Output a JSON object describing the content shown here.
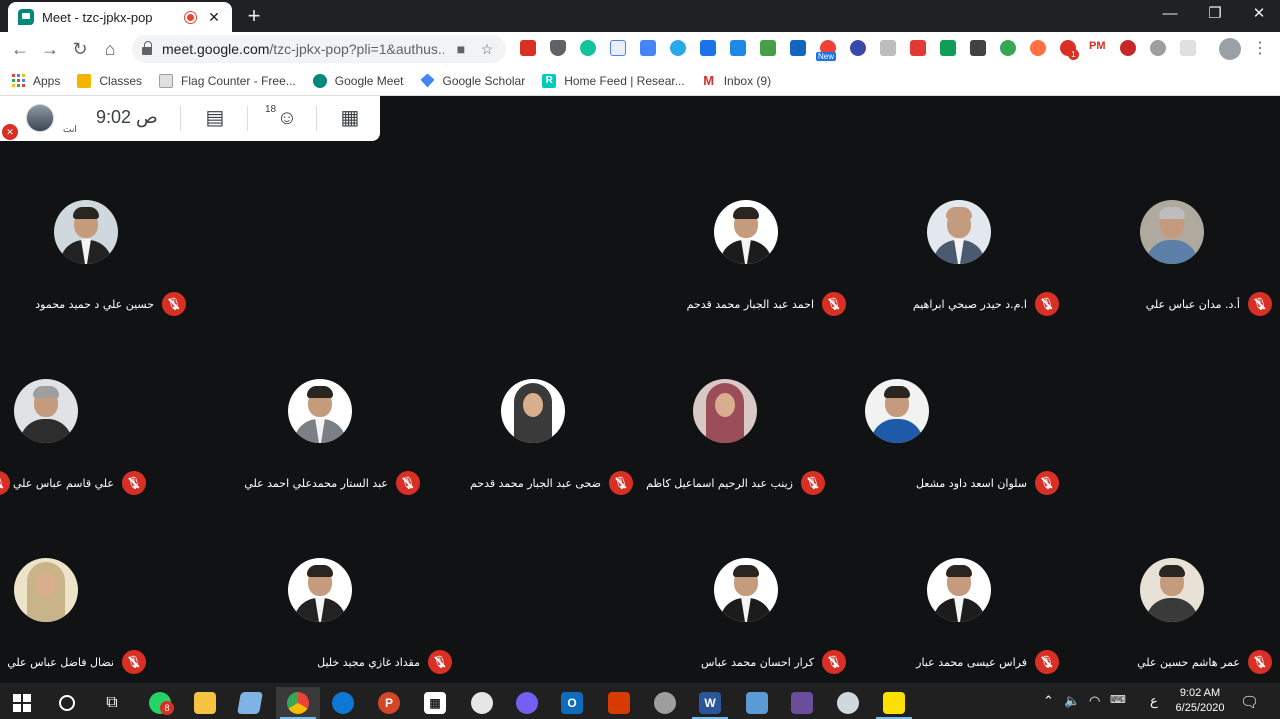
{
  "browser": {
    "tab_title": "Meet - tzc-jpkx-pop",
    "tab_close": "✕",
    "new_tab": "+",
    "minimize": "—",
    "restore": "❐",
    "close": "✕",
    "url_host": "meet.google.com",
    "url_path": "/tzc-jpkx-pop?pli=1&authus...",
    "extension_text_pm": "PM",
    "extension_badge_new": "New",
    "extension_badge_count": "1"
  },
  "bookmarks": [
    {
      "label": "Apps",
      "icon": "apps-grid-icon",
      "color": "#4285f4"
    },
    {
      "label": "Classes",
      "icon": "classes-icon",
      "color": "#f4b400"
    },
    {
      "label": "Flag Counter - Free...",
      "icon": "flag-counter-icon",
      "color": "#9aa0a6"
    },
    {
      "label": "Google Meet",
      "icon": "google-meet-icon",
      "color": "#00897b"
    },
    {
      "label": "Google Scholar",
      "icon": "google-scholar-icon",
      "color": "#4285f4"
    },
    {
      "label": "Home Feed | Resear...",
      "icon": "researchgate-icon",
      "color": "#00ccbb"
    },
    {
      "label": "Inbox (9)",
      "icon": "gmail-icon",
      "color": "#d93025"
    }
  ],
  "meet": {
    "time": "9:02 ص",
    "self_label": "انت",
    "people_count": "18",
    "participants": [
      {
        "name": "حسين علي د حميد محمود"
      },
      {
        "name": "احمد عبد الجبار محمد قدحم"
      },
      {
        "name": "ا.م.د حيدر صبحي ابراهيم"
      },
      {
        "name": "أ.د. مدان عباس علي"
      },
      {
        "name": "علي قاسم عباس علي"
      },
      {
        "name": "عبد الستار محمدعلي احمد علي"
      },
      {
        "name": "ضحى عبد الجبار محمد قدحم"
      },
      {
        "name": "زينب عبد الرحيم اسماعيل كاظم"
      },
      {
        "name": "سلوان اسعد داود مشعل"
      },
      {
        "name": "نضال فاضل عباس علي"
      },
      {
        "name": "مقداد غازي مجيد خليل"
      },
      {
        "name": "كرار احسان محمد عباس"
      },
      {
        "name": "فراس عيسى محمد عبار"
      },
      {
        "name": "عمر هاشم حسين علي"
      }
    ]
  },
  "taskbar": {
    "whatsapp_badge": "8",
    "ime": "ع",
    "time": "9:02 AM",
    "date": "6/25/2020"
  }
}
